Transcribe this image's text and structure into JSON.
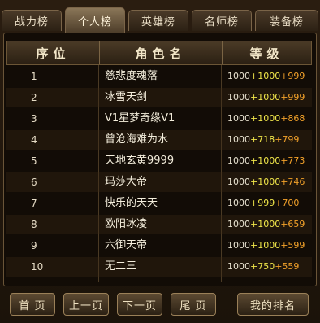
{
  "tabs": [
    {
      "label": "战力榜"
    },
    {
      "label": "个人榜"
    },
    {
      "label": "英雄榜"
    },
    {
      "label": "名师榜"
    },
    {
      "label": "装备榜"
    }
  ],
  "active_tab": 1,
  "columns": {
    "rank": "序位",
    "name": "角色名",
    "level": "等级"
  },
  "rows": [
    {
      "rank": "1",
      "name": "慈悲度魂落",
      "base": "1000",
      "p1": "+1000",
      "p2": "+999"
    },
    {
      "rank": "2",
      "name": "冰雪天剑",
      "base": "1000",
      "p1": "+1000",
      "p2": "+999"
    },
    {
      "rank": "3",
      "name": "V1星梦奇缘V1",
      "base": "1000",
      "p1": "+1000",
      "p2": "+868"
    },
    {
      "rank": "4",
      "name": "曾沧海难为水",
      "base": "1000",
      "p1": "+718",
      "p2": "+799"
    },
    {
      "rank": "5",
      "name": "天地玄黄9999",
      "base": "1000",
      "p1": "+1000",
      "p2": "+773"
    },
    {
      "rank": "6",
      "name": "玛莎大帝",
      "base": "1000",
      "p1": "+1000",
      "p2": "+746"
    },
    {
      "rank": "7",
      "name": "快乐的天天",
      "base": "1000",
      "p1": "+999",
      "p2": "+700"
    },
    {
      "rank": "8",
      "name": "欧阳冰凌",
      "base": "1000",
      "p1": "+1000",
      "p2": "+659"
    },
    {
      "rank": "9",
      "name": "六御天帝",
      "base": "1000",
      "p1": "+1000",
      "p2": "+599"
    },
    {
      "rank": "10",
      "name": "无二三",
      "base": "1000",
      "p1": "+750",
      "p2": "+559"
    }
  ],
  "buttons": {
    "first": "首 页",
    "prev": "上一页",
    "next": "下一页",
    "last": "尾 页",
    "my_rank": "我的排名"
  }
}
